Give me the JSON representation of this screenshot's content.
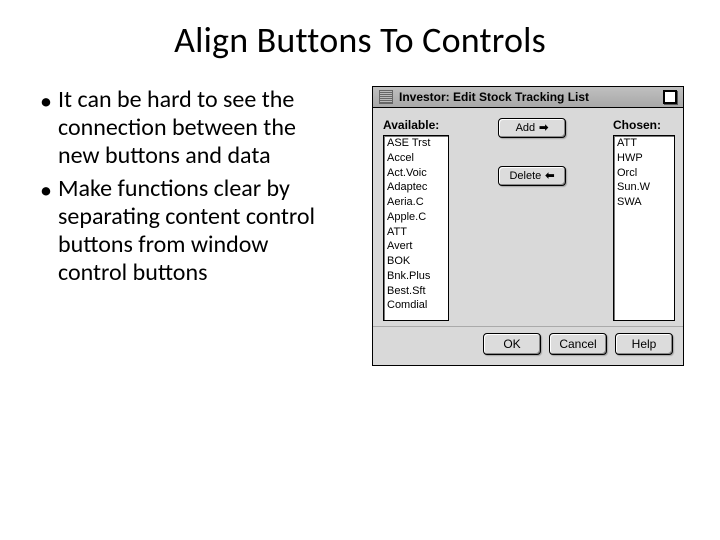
{
  "slide": {
    "title": "Align Buttons To Controls",
    "bullets": [
      "It can be hard to see the connection between the new buttons and data",
      "Make functions clear by separating content control buttons from window control buttons"
    ]
  },
  "dialog": {
    "title": "Investor: Edit Stock Tracking List",
    "labels": {
      "available": "Available:",
      "chosen": "Chosen:"
    },
    "available": [
      "ASE Trst",
      "Accel",
      "Act.Voic",
      "Adaptec",
      "Aeria.C",
      "Apple.C",
      "ATT",
      "Avert",
      "BOK",
      "Bnk.Plus",
      "Best.Sft",
      "Comdial"
    ],
    "chosen": [
      "ATT",
      "HWP",
      "Orcl",
      "Sun.W",
      "SWA"
    ],
    "buttons": {
      "add": "Add",
      "delete": "Delete",
      "ok": "OK",
      "cancel": "Cancel",
      "help": "Help"
    }
  }
}
